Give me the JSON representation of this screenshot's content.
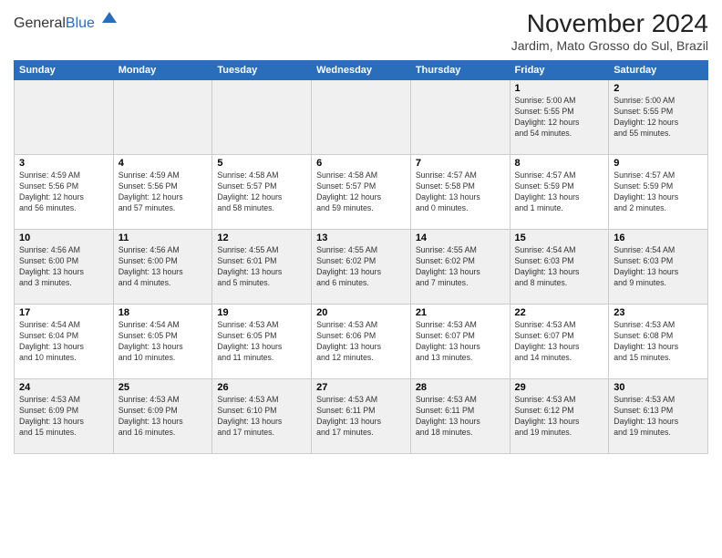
{
  "header": {
    "logo_general": "General",
    "logo_blue": "Blue",
    "month_title": "November 2024",
    "location": "Jardim, Mato Grosso do Sul, Brazil"
  },
  "weekdays": [
    "Sunday",
    "Monday",
    "Tuesday",
    "Wednesday",
    "Thursday",
    "Friday",
    "Saturday"
  ],
  "weeks": [
    [
      {
        "day": "",
        "info": ""
      },
      {
        "day": "",
        "info": ""
      },
      {
        "day": "",
        "info": ""
      },
      {
        "day": "",
        "info": ""
      },
      {
        "day": "",
        "info": ""
      },
      {
        "day": "1",
        "info": "Sunrise: 5:00 AM\nSunset: 5:55 PM\nDaylight: 12 hours\nand 54 minutes."
      },
      {
        "day": "2",
        "info": "Sunrise: 5:00 AM\nSunset: 5:55 PM\nDaylight: 12 hours\nand 55 minutes."
      }
    ],
    [
      {
        "day": "3",
        "info": "Sunrise: 4:59 AM\nSunset: 5:56 PM\nDaylight: 12 hours\nand 56 minutes."
      },
      {
        "day": "4",
        "info": "Sunrise: 4:59 AM\nSunset: 5:56 PM\nDaylight: 12 hours\nand 57 minutes."
      },
      {
        "day": "5",
        "info": "Sunrise: 4:58 AM\nSunset: 5:57 PM\nDaylight: 12 hours\nand 58 minutes."
      },
      {
        "day": "6",
        "info": "Sunrise: 4:58 AM\nSunset: 5:57 PM\nDaylight: 12 hours\nand 59 minutes."
      },
      {
        "day": "7",
        "info": "Sunrise: 4:57 AM\nSunset: 5:58 PM\nDaylight: 13 hours\nand 0 minutes."
      },
      {
        "day": "8",
        "info": "Sunrise: 4:57 AM\nSunset: 5:59 PM\nDaylight: 13 hours\nand 1 minute."
      },
      {
        "day": "9",
        "info": "Sunrise: 4:57 AM\nSunset: 5:59 PM\nDaylight: 13 hours\nand 2 minutes."
      }
    ],
    [
      {
        "day": "10",
        "info": "Sunrise: 4:56 AM\nSunset: 6:00 PM\nDaylight: 13 hours\nand 3 minutes."
      },
      {
        "day": "11",
        "info": "Sunrise: 4:56 AM\nSunset: 6:00 PM\nDaylight: 13 hours\nand 4 minutes."
      },
      {
        "day": "12",
        "info": "Sunrise: 4:55 AM\nSunset: 6:01 PM\nDaylight: 13 hours\nand 5 minutes."
      },
      {
        "day": "13",
        "info": "Sunrise: 4:55 AM\nSunset: 6:02 PM\nDaylight: 13 hours\nand 6 minutes."
      },
      {
        "day": "14",
        "info": "Sunrise: 4:55 AM\nSunset: 6:02 PM\nDaylight: 13 hours\nand 7 minutes."
      },
      {
        "day": "15",
        "info": "Sunrise: 4:54 AM\nSunset: 6:03 PM\nDaylight: 13 hours\nand 8 minutes."
      },
      {
        "day": "16",
        "info": "Sunrise: 4:54 AM\nSunset: 6:03 PM\nDaylight: 13 hours\nand 9 minutes."
      }
    ],
    [
      {
        "day": "17",
        "info": "Sunrise: 4:54 AM\nSunset: 6:04 PM\nDaylight: 13 hours\nand 10 minutes."
      },
      {
        "day": "18",
        "info": "Sunrise: 4:54 AM\nSunset: 6:05 PM\nDaylight: 13 hours\nand 10 minutes."
      },
      {
        "day": "19",
        "info": "Sunrise: 4:53 AM\nSunset: 6:05 PM\nDaylight: 13 hours\nand 11 minutes."
      },
      {
        "day": "20",
        "info": "Sunrise: 4:53 AM\nSunset: 6:06 PM\nDaylight: 13 hours\nand 12 minutes."
      },
      {
        "day": "21",
        "info": "Sunrise: 4:53 AM\nSunset: 6:07 PM\nDaylight: 13 hours\nand 13 minutes."
      },
      {
        "day": "22",
        "info": "Sunrise: 4:53 AM\nSunset: 6:07 PM\nDaylight: 13 hours\nand 14 minutes."
      },
      {
        "day": "23",
        "info": "Sunrise: 4:53 AM\nSunset: 6:08 PM\nDaylight: 13 hours\nand 15 minutes."
      }
    ],
    [
      {
        "day": "24",
        "info": "Sunrise: 4:53 AM\nSunset: 6:09 PM\nDaylight: 13 hours\nand 15 minutes."
      },
      {
        "day": "25",
        "info": "Sunrise: 4:53 AM\nSunset: 6:09 PM\nDaylight: 13 hours\nand 16 minutes."
      },
      {
        "day": "26",
        "info": "Sunrise: 4:53 AM\nSunset: 6:10 PM\nDaylight: 13 hours\nand 17 minutes."
      },
      {
        "day": "27",
        "info": "Sunrise: 4:53 AM\nSunset: 6:11 PM\nDaylight: 13 hours\nand 17 minutes."
      },
      {
        "day": "28",
        "info": "Sunrise: 4:53 AM\nSunset: 6:11 PM\nDaylight: 13 hours\nand 18 minutes."
      },
      {
        "day": "29",
        "info": "Sunrise: 4:53 AM\nSunset: 6:12 PM\nDaylight: 13 hours\nand 19 minutes."
      },
      {
        "day": "30",
        "info": "Sunrise: 4:53 AM\nSunset: 6:13 PM\nDaylight: 13 hours\nand 19 minutes."
      }
    ]
  ]
}
